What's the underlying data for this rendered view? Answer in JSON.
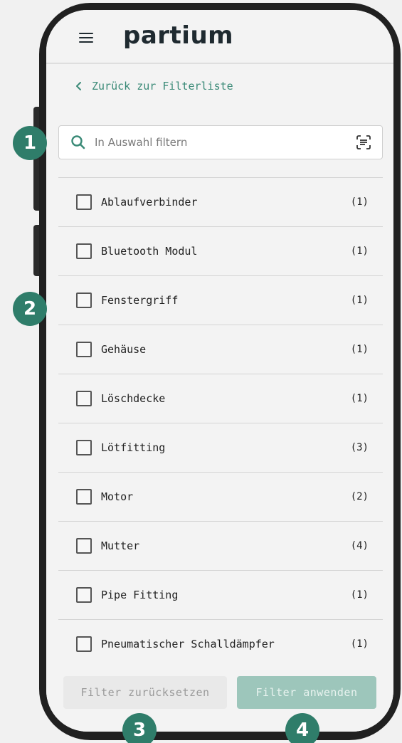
{
  "header": {
    "brand": "partium",
    "menu_icon": "hamburger-menu-icon"
  },
  "back_link": {
    "label": "Zurück zur Filterliste",
    "icon": "chevron-left-icon"
  },
  "search": {
    "placeholder": "In Auswahl filtern",
    "value": "",
    "icon": "search-icon",
    "scan_icon": "scan-icon"
  },
  "filter_items": [
    {
      "label": "Ablaufverbinder",
      "count": "(1)",
      "checked": false
    },
    {
      "label": "Bluetooth Modul",
      "count": "(1)",
      "checked": false
    },
    {
      "label": "Fenstergriff",
      "count": "(1)",
      "checked": false
    },
    {
      "label": "Gehäuse",
      "count": "(1)",
      "checked": false
    },
    {
      "label": "Löschdecke",
      "count": "(1)",
      "checked": false
    },
    {
      "label": "Lötfitting",
      "count": "(3)",
      "checked": false
    },
    {
      "label": "Motor",
      "count": "(2)",
      "checked": false
    },
    {
      "label": "Mutter",
      "count": "(4)",
      "checked": false
    },
    {
      "label": "Pipe Fitting",
      "count": "(1)",
      "checked": false
    },
    {
      "label": "Pneumatischer Schalldämpfer",
      "count": "(1)",
      "checked": false
    }
  ],
  "footer": {
    "reset_label": "Filter zurücksetzen",
    "apply_label": "Filter anwenden"
  },
  "badges": [
    "1",
    "2",
    "3",
    "4"
  ],
  "colors": {
    "accent": "#3a8a77",
    "badge": "#2f7d6a",
    "apply_button": "#9dc6bb",
    "text_dark": "#1f2a30"
  }
}
